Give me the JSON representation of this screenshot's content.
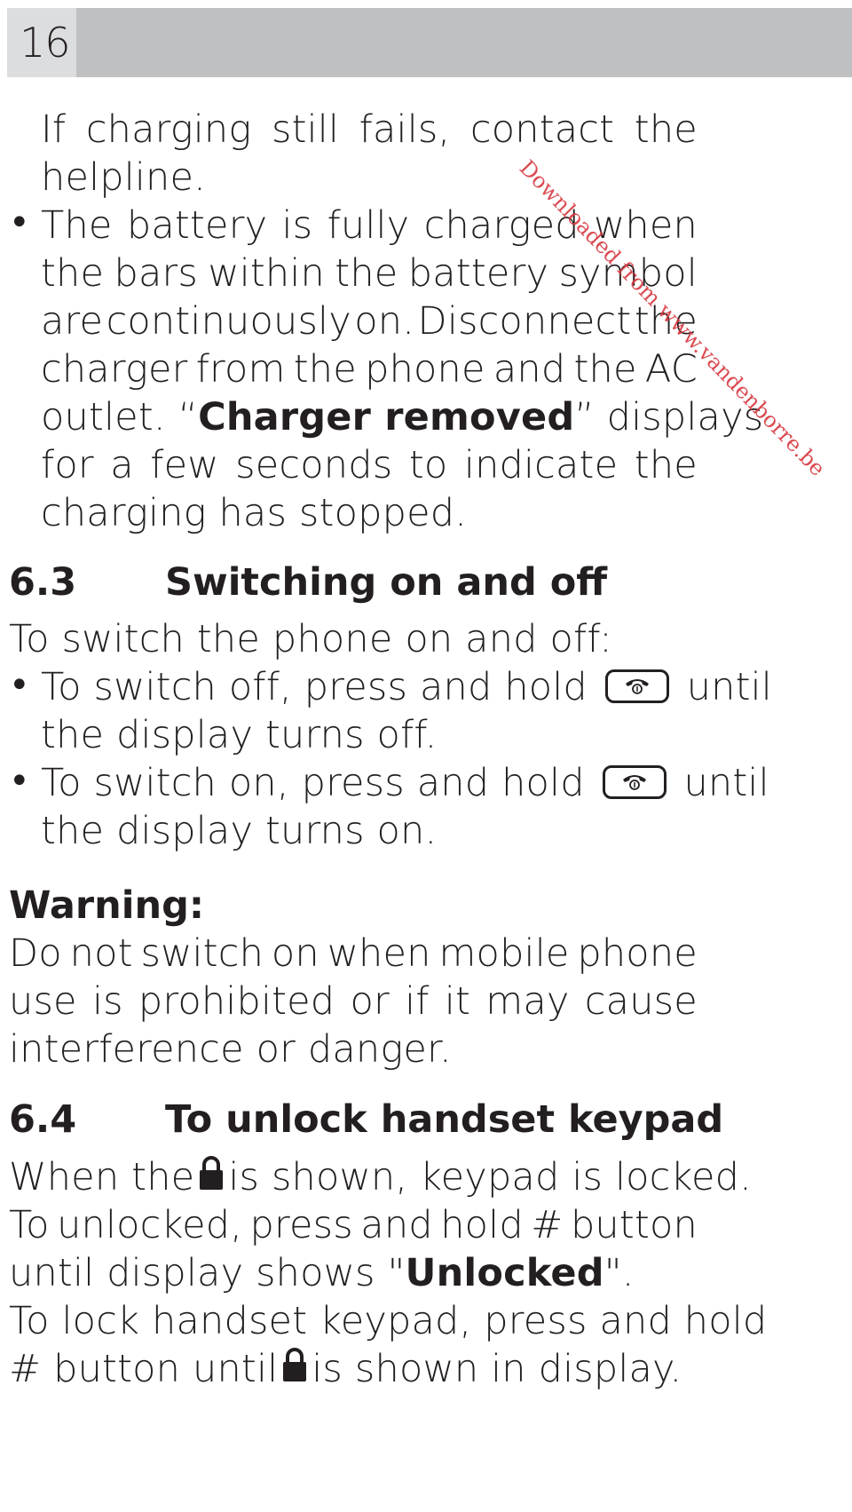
{
  "page": {
    "number": "16"
  },
  "intro": {
    "line1": [
      "If",
      "charging",
      "still",
      "fails,",
      "contact",
      "the"
    ],
    "line2": "helpline."
  },
  "bullet_battery": {
    "lines": [
      [
        "The",
        "battery",
        "is",
        "fully",
        "charged",
        "when"
      ],
      [
        "the",
        "bars",
        "within",
        "the",
        "battery",
        "symbol"
      ],
      [
        "are",
        "continuously",
        "on.",
        "Disconnect",
        "the"
      ],
      [
        "charger",
        "from",
        "the",
        "phone",
        "and",
        "the",
        "AC"
      ]
    ],
    "line5_pre": "outlet. “",
    "line5_bold": "Charger removed",
    "line5_post": "”  displays",
    "line6": [
      "for",
      "a",
      "few",
      "seconds",
      "to",
      "indicate",
      "the"
    ],
    "line7": "charging has stopped."
  },
  "section_6_3": {
    "number": "6.3",
    "title": "Switching on and off",
    "intro": "To switch the phone on and off:",
    "bullets": [
      {
        "pre": "To switch off, press and hold",
        "icon": "end-call-key-icon",
        "post": "until",
        "cont": "the display turns off."
      },
      {
        "pre": "To switch on, press and hold",
        "icon": "end-call-key-icon",
        "post": "until",
        "cont": "the display turns on."
      }
    ]
  },
  "warning": {
    "label": "Warning:",
    "lines": [
      [
        "Do",
        "not",
        "switch",
        "on",
        "when",
        "mobile",
        "phone"
      ],
      [
        "use",
        "is",
        "prohibited",
        "or",
        "if",
        "it",
        "may",
        "cause"
      ]
    ],
    "last": "interference or danger."
  },
  "section_6_4": {
    "number": "6.4",
    "title": "To unlock handset keypad",
    "l1_pre": "When the",
    "l1_post": "is shown, keypad is locked.",
    "l2": [
      "To",
      "unlocked,",
      "press",
      "and",
      "hold",
      "#",
      "button"
    ],
    "l3_pre": "until display shows \"",
    "l3_bold": "Unlocked",
    "l3_post": "\".",
    "l4": "To lock handset keypad, press and hold",
    "l5_pre": "# button until",
    "l5_post": "is shown in display."
  },
  "watermark": "Downloaded from www.vandenborre.be",
  "colors": {
    "header_bar": "#bfc0c2",
    "page_num_box": "#dcdddf",
    "text": "#231f20",
    "watermark": "#d7373f"
  }
}
